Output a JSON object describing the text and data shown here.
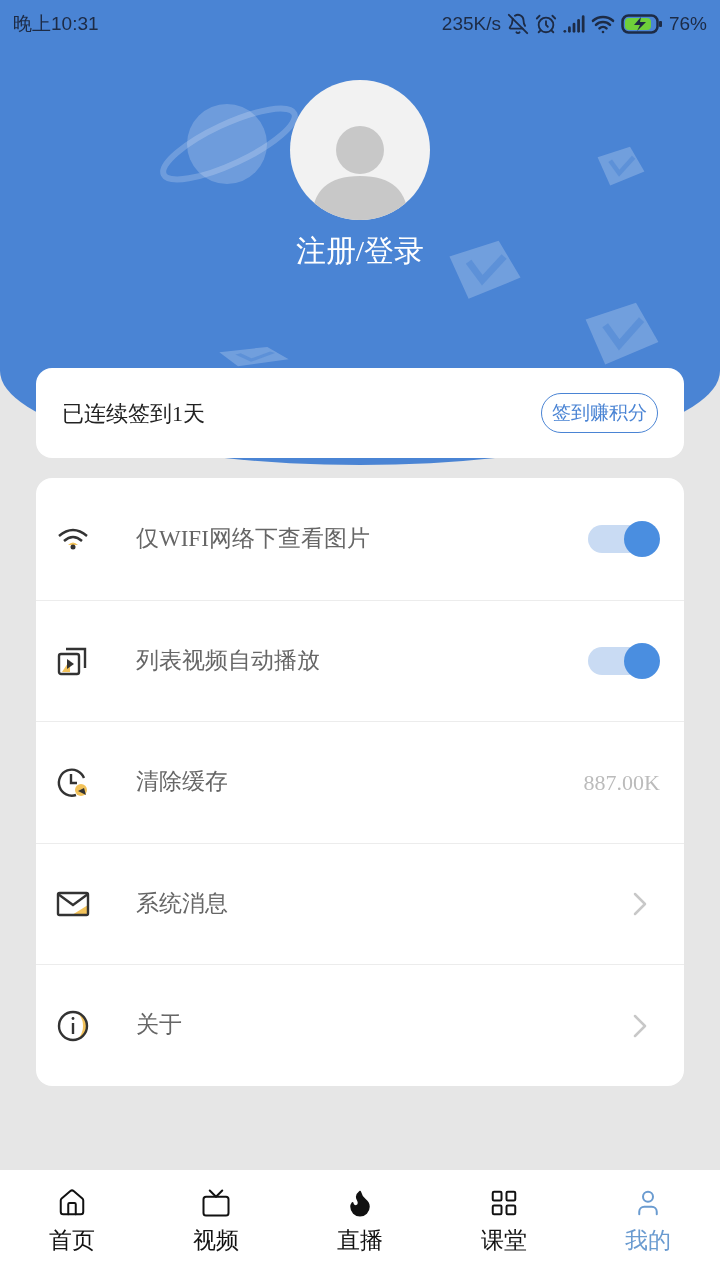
{
  "status_bar": {
    "time": "晚上10:31",
    "speed": "235K/s",
    "battery": "76%"
  },
  "profile": {
    "name": "注册/登录"
  },
  "checkin": {
    "text": "已连续签到1天",
    "button": "签到赚积分"
  },
  "settings": [
    {
      "kind": "toggle",
      "label": "仅WIFI网络下查看图片",
      "on": true
    },
    {
      "kind": "toggle",
      "label": "列表视频自动播放",
      "on": true
    },
    {
      "kind": "value",
      "label": "清除缓存",
      "value": "887.00K"
    },
    {
      "kind": "link",
      "label": "系统消息"
    },
    {
      "kind": "link",
      "label": "关于"
    }
  ],
  "nav": [
    {
      "label": "首页",
      "selected": false
    },
    {
      "label": "视频",
      "selected": false
    },
    {
      "label": "直播",
      "selected": false
    },
    {
      "label": "课堂",
      "selected": false
    },
    {
      "label": "我的",
      "selected": true
    }
  ]
}
